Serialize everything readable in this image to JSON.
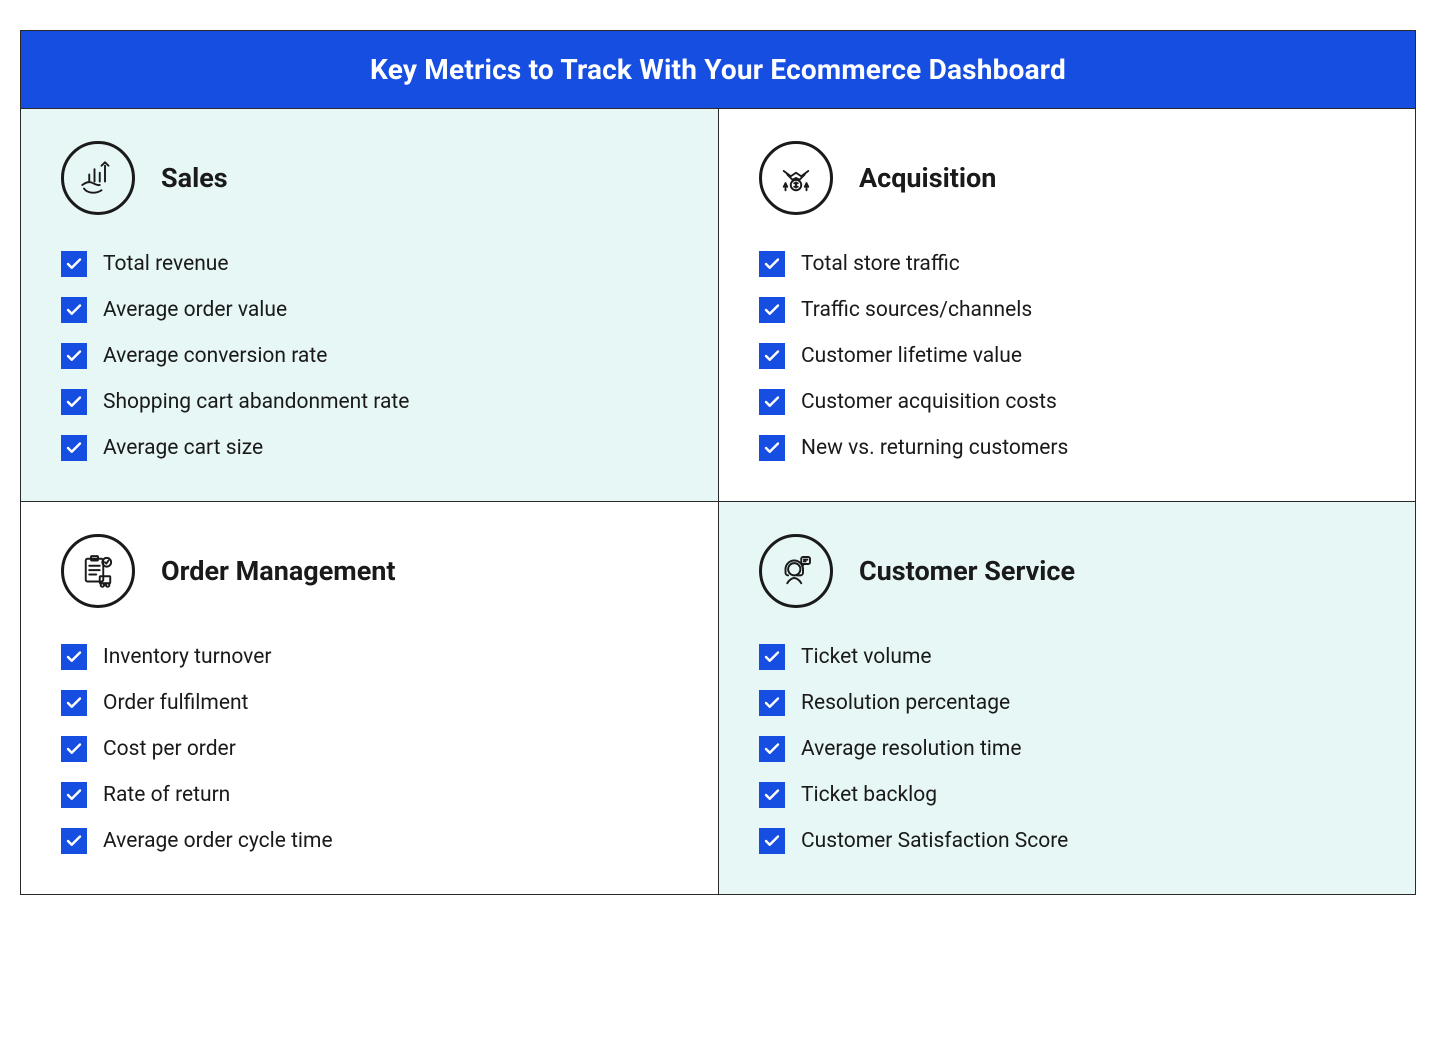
{
  "title": "Key Metrics to Track With Your Ecommerce Dashboard",
  "quadrants": [
    {
      "id": "sales",
      "title": "Sales",
      "tinted": true,
      "items": [
        "Total revenue",
        "Average order value",
        "Average conversion rate",
        "Shopping cart abandonment rate",
        "Average cart size"
      ]
    },
    {
      "id": "acquisition",
      "title": "Acquisition",
      "tinted": false,
      "items": [
        "Total store traffic",
        "Traffic sources/channels",
        "Customer lifetime value",
        "Customer acquisition costs",
        "New vs. returning customers"
      ]
    },
    {
      "id": "order-management",
      "title": "Order Management",
      "tinted": false,
      "items": [
        "Inventory turnover",
        "Order fulfilment",
        "Cost per order",
        "Rate of return",
        "Average order cycle time"
      ]
    },
    {
      "id": "customer-service",
      "title": "Customer Service",
      "tinted": true,
      "items": [
        "Ticket volume",
        "Resolution percentage",
        "Average resolution time",
        "Ticket backlog",
        "Customer Satisfaction Score"
      ]
    }
  ]
}
